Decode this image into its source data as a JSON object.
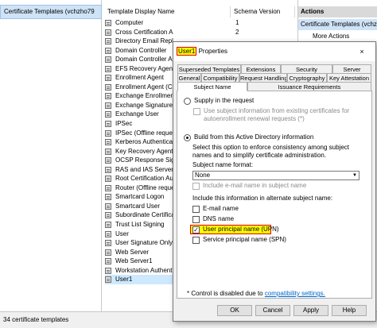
{
  "tree": {
    "selected_node": "Certificate Templates (vchzho79"
  },
  "list": {
    "columns": [
      "Template Display Name",
      "Schema Version"
    ],
    "rows": [
      {
        "name": "Computer",
        "version": "1"
      },
      {
        "name": "Cross Certification Authority",
        "version": "2"
      },
      {
        "name": "Directory Email Replication",
        "version": ""
      },
      {
        "name": "Domain Controller",
        "version": ""
      },
      {
        "name": "Domain Controller Au",
        "version": ""
      },
      {
        "name": "EFS Recovery Agent",
        "version": ""
      },
      {
        "name": "Enrollment Agent",
        "version": ""
      },
      {
        "name": "Enrollment Agent (Co",
        "version": ""
      },
      {
        "name": "Exchange Enrollment",
        "version": ""
      },
      {
        "name": "Exchange Signature O",
        "version": ""
      },
      {
        "name": "Exchange User",
        "version": ""
      },
      {
        "name": "IPSec",
        "version": ""
      },
      {
        "name": "IPSec (Offline reques",
        "version": ""
      },
      {
        "name": "Kerberos Authenticat",
        "version": ""
      },
      {
        "name": "Key Recovery Agent",
        "version": ""
      },
      {
        "name": "OCSP Response Signi",
        "version": ""
      },
      {
        "name": "RAS and IAS Server",
        "version": ""
      },
      {
        "name": "Root Certification Au",
        "version": ""
      },
      {
        "name": "Router (Offline reque",
        "version": ""
      },
      {
        "name": "Smartcard Logon",
        "version": ""
      },
      {
        "name": "Smartcard User",
        "version": ""
      },
      {
        "name": "Subordinate Certificat",
        "version": ""
      },
      {
        "name": "Trust List Signing",
        "version": ""
      },
      {
        "name": "User",
        "version": ""
      },
      {
        "name": "User Signature Only",
        "version": ""
      },
      {
        "name": "Web Server",
        "version": ""
      },
      {
        "name": "Web Server1",
        "version": ""
      },
      {
        "name": "Workstation Authent",
        "version": ""
      },
      {
        "name": "User1",
        "version": ""
      }
    ]
  },
  "actions": {
    "title": "Actions",
    "context": "Certificate Templates (vchzho79",
    "more": "More Actions"
  },
  "status": {
    "text": "34 certificate templates"
  },
  "dialog": {
    "title_highlight": "User1",
    "title_rest": " Properties",
    "close_glyph": "×",
    "tabs_row1": [
      "Superseded Templates",
      "Extensions",
      "Security",
      "Server"
    ],
    "tabs_row2": [
      "General",
      "Compatibility",
      "Request Handling",
      "Cryptography",
      "Key Attestation"
    ],
    "tabs_row3": [
      "Subject Name",
      "Issuance Requirements"
    ],
    "supply_label": "Supply in the request",
    "supply_note": "Use subject information from existing certificates for autoenrollment renewal requests (*)",
    "build_label": "Build from this Active Directory information",
    "build_desc": "Select this option to enforce consistency among subject names and to simplify certificate administration.",
    "format_label": "Subject name format:",
    "format_value": "None",
    "include_email": "Include e-mail name in subject name",
    "alt_label": "Include this information in alternate subject name:",
    "alt_options": [
      {
        "label": "E-mail name",
        "checked": false
      },
      {
        "label": "DNS name",
        "checked": false
      },
      {
        "label": "User principal name (UPN)",
        "checked": true
      },
      {
        "label": "Service principal name (SPN)",
        "checked": false
      }
    ],
    "footnote_pre": "* Control is disabled due to ",
    "footnote_link": "compatibility settings.",
    "buttons": [
      "OK",
      "Cancel",
      "Apply",
      "Help"
    ]
  },
  "colors": {
    "highlight": "#ffff00",
    "outline": "#e00000",
    "selection": "#cde8ff"
  }
}
